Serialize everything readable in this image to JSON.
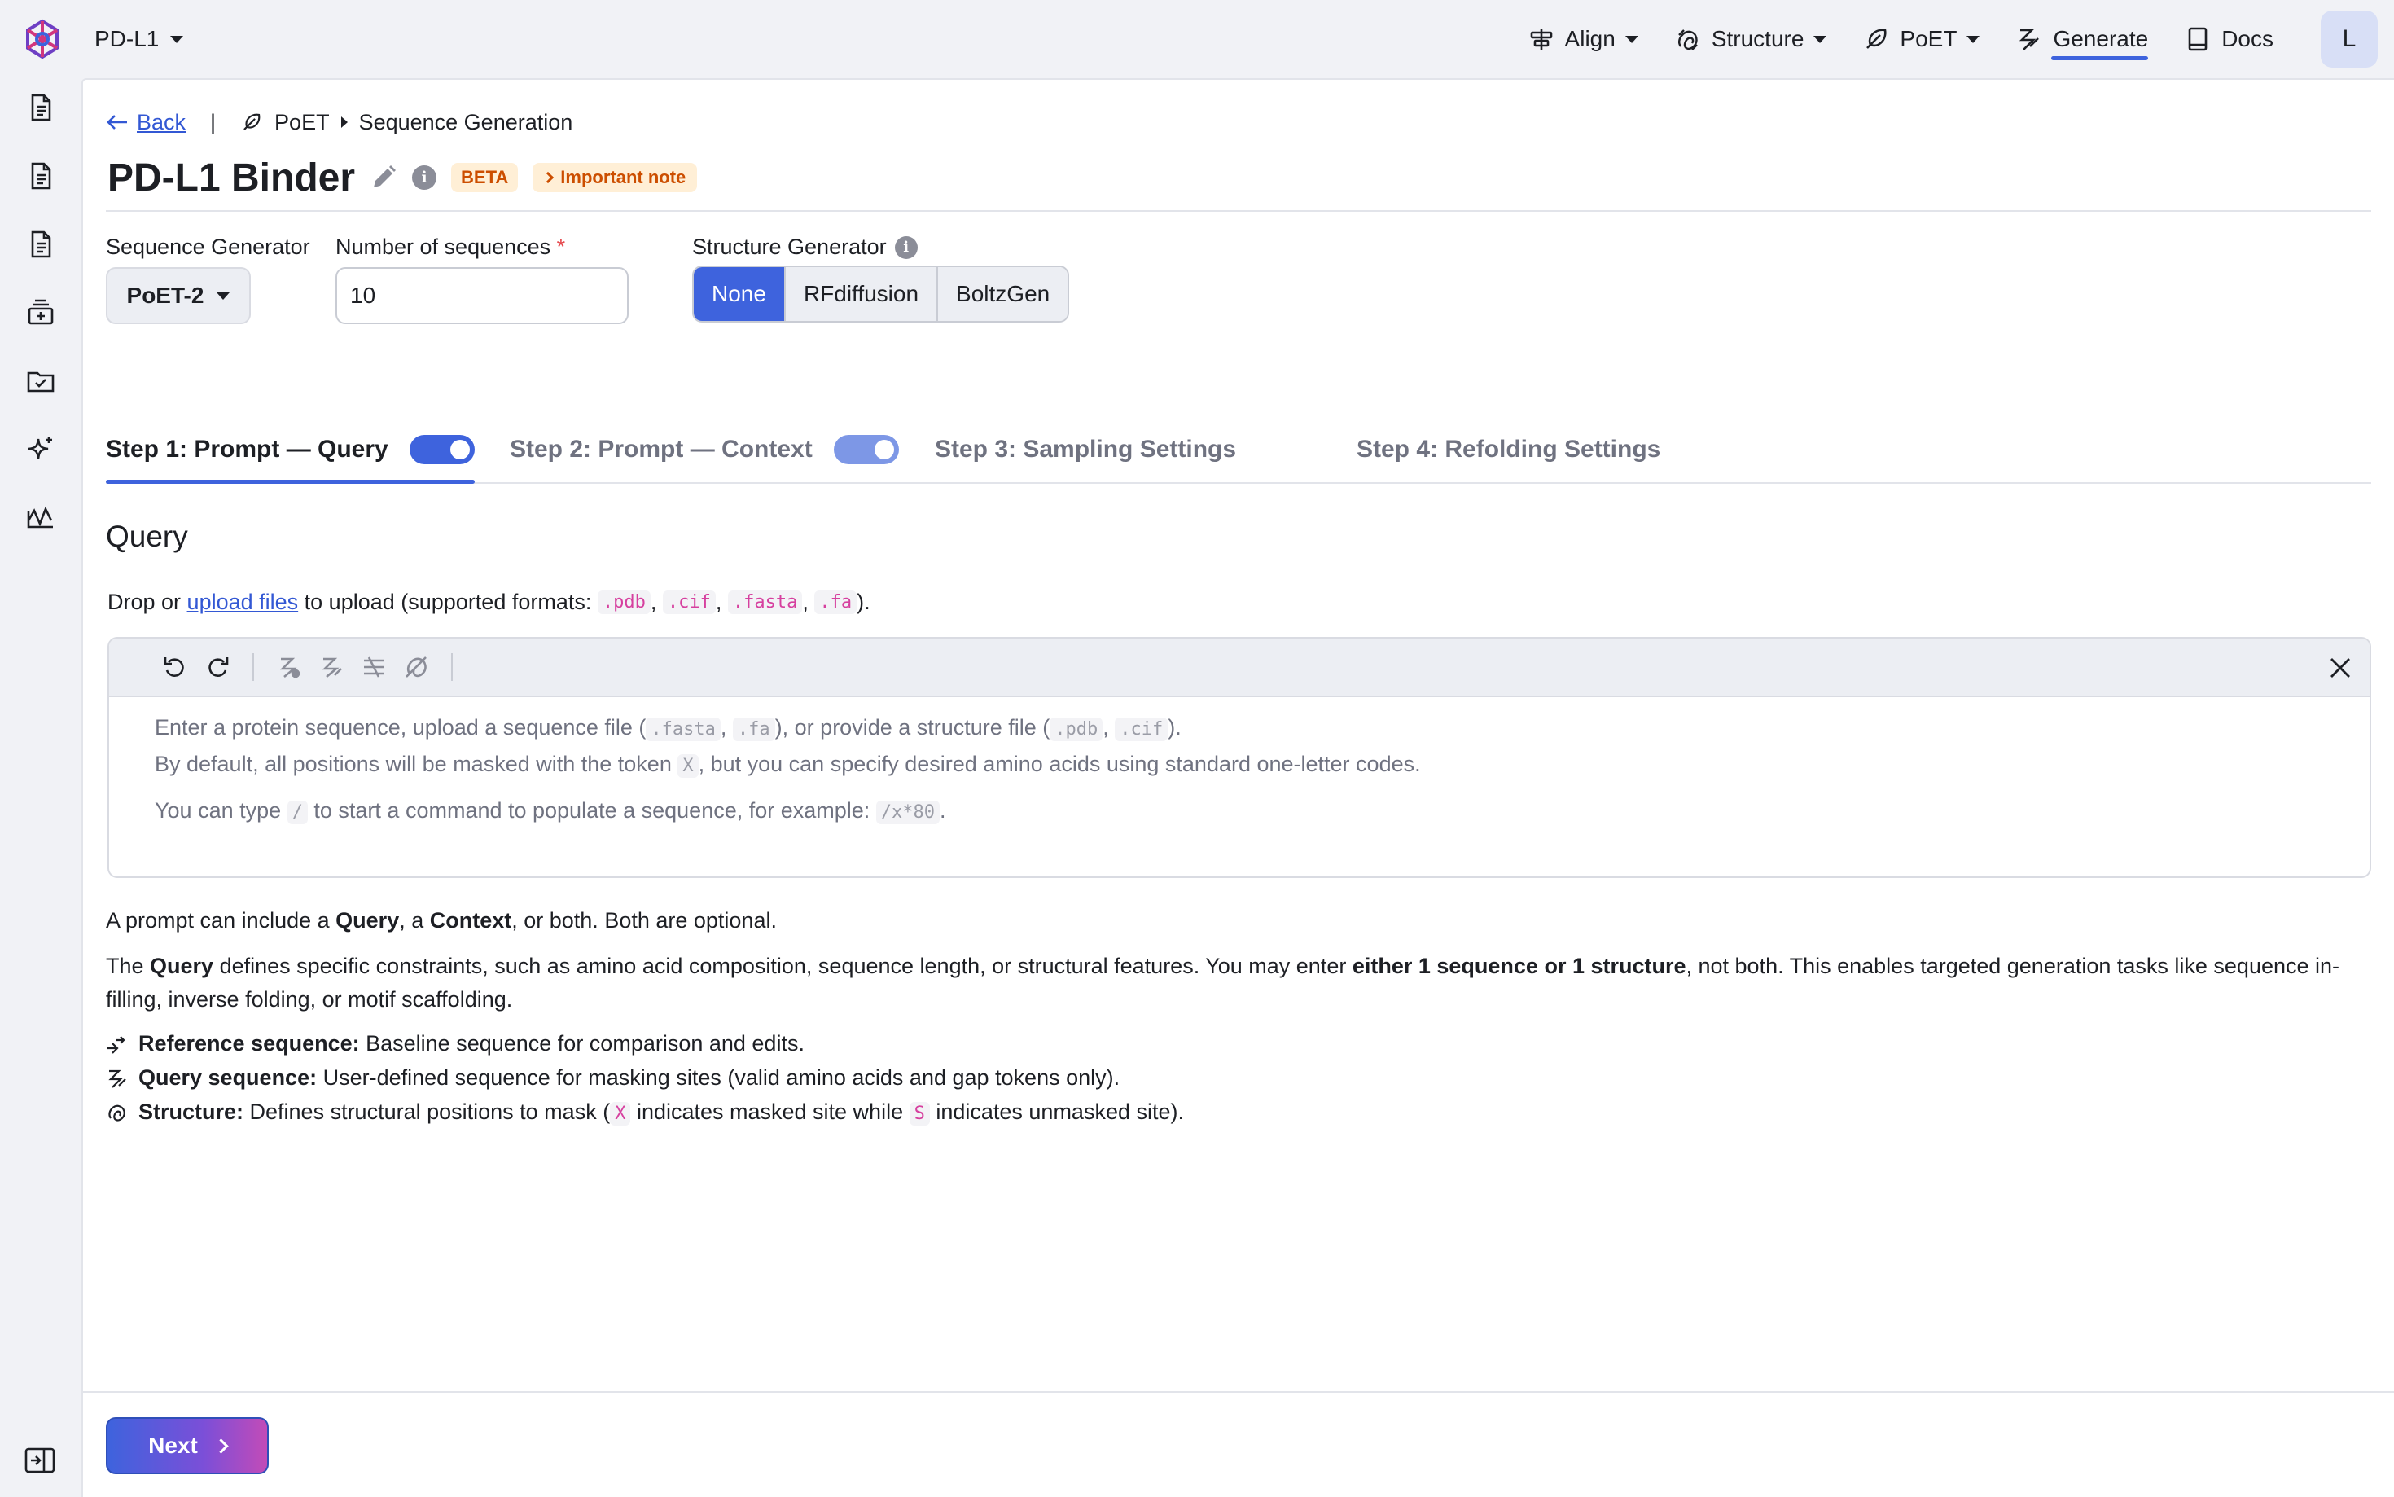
{
  "app": {
    "project": "PD-L1",
    "user_initial": "L"
  },
  "nav": {
    "items": [
      {
        "label": "Align",
        "icon": "align-icon",
        "has_dropdown": true
      },
      {
        "label": "Structure",
        "icon": "structure-icon",
        "has_dropdown": true
      },
      {
        "label": "PoET",
        "icon": "feather-icon",
        "has_dropdown": true
      },
      {
        "label": "Generate",
        "icon": "generate-icon",
        "has_dropdown": false,
        "active": true
      },
      {
        "label": "Docs",
        "icon": "book-icon",
        "has_dropdown": false
      }
    ]
  },
  "sidebar": {
    "icons": [
      "document-icon",
      "document-icon",
      "document-icon",
      "dataset-icon",
      "folder-check-icon",
      "sparkle-icon",
      "chart-icon"
    ],
    "collapse_icon": "sidebar-collapse-icon"
  },
  "breadcrumb": {
    "back": "Back",
    "separator": "|",
    "section": "PoET",
    "page": "Sequence Generation"
  },
  "header": {
    "title": "PD-L1 Binder",
    "info": "i",
    "beta": "BETA",
    "note": "Important note"
  },
  "form": {
    "generator_label": "Sequence Generator",
    "generator_value": "PoET-2",
    "num_label": "Number of sequences",
    "num_required": "*",
    "num_value": "10",
    "structure_label": "Structure Generator",
    "structure_options": [
      "None",
      "RFdiffusion",
      "BoltzGen"
    ],
    "structure_selected": "None"
  },
  "steps": [
    {
      "label": "Step 1: Prompt — Query",
      "toggle": true,
      "active": true
    },
    {
      "label": "Step 2: Prompt — Context",
      "toggle": true,
      "active": false
    },
    {
      "label": "Step 3: Sampling Settings",
      "toggle": false,
      "active": false
    },
    {
      "label": "Step 4: Refolding Settings",
      "toggle": false,
      "active": false
    }
  ],
  "query": {
    "title": "Query",
    "drop_prefix": "Drop or ",
    "upload_link": "upload files",
    "drop_suffix": " to upload (supported formats: ",
    "formats": [
      ".pdb",
      ".cif",
      ".fasta",
      ".fa"
    ],
    "drop_end": ").",
    "placeholder": {
      "l1_a": "Enter a protein sequence, upload a sequence file (",
      "l1_c1": ".fasta",
      "l1_b": ", ",
      "l1_c2": ".fa",
      "l1_d": "), or provide a structure file (",
      "l1_c3": ".pdb",
      "l1_e": ", ",
      "l1_c4": ".cif",
      "l1_f": ").",
      "l2_a": "By default, all positions will be masked with the token ",
      "l2_c": "X",
      "l2_b": ", but you can specify desired amino acids using standard one-letter codes.",
      "l3_a": "You can type ",
      "l3_c": "/",
      "l3_b": " to start a command to populate a sequence, for example: ",
      "l3_c2": "/x*80",
      "l3_d": "."
    }
  },
  "description": {
    "p1_a": "A prompt can include a ",
    "p1_b": "Query",
    "p1_c": ", a ",
    "p1_d": "Context",
    "p1_e": ", or both. Both are optional.",
    "p2_a": "The ",
    "p2_b": "Query",
    "p2_c": " defines specific constraints, such as amino acid composition, sequence length, or structural features. You may enter ",
    "p2_d": "either 1 sequence or 1 structure",
    "p2_e": ", not both. This enables targeted generation tasks like sequence in-filling, inverse folding, or motif scaffolding."
  },
  "legend": [
    {
      "term": "Reference sequence:",
      "text": " Baseline sequence for comparison and edits.",
      "icon": "reference-icon"
    },
    {
      "term": "Query sequence:",
      "text": " User-defined sequence for masking sites (valid amino acids and gap tokens only).",
      "icon": "query-icon"
    },
    {
      "term": "Structure:",
      "text_a": " Defines structural positions to mask (",
      "code_x": "X",
      "text_b": " indicates masked site while ",
      "code_s": "S",
      "text_c": " indicates unmasked site).",
      "icon": "structure-icon"
    }
  ],
  "footer": {
    "next": "Next"
  },
  "colors": {
    "accent": "#3e63dd",
    "code": "#d6409f",
    "warning": "#cc4e00"
  }
}
